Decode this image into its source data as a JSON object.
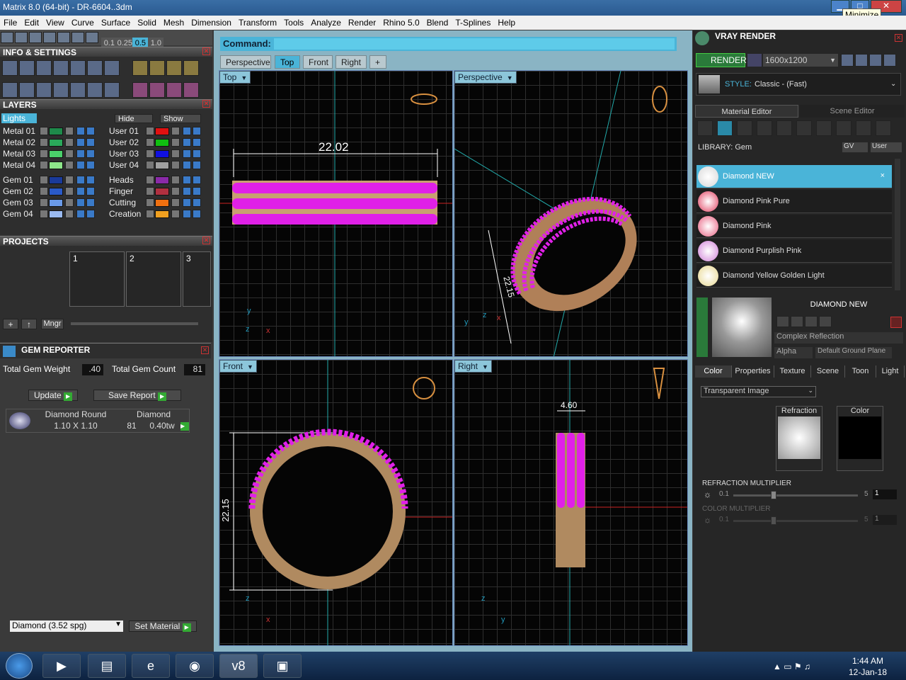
{
  "window": {
    "title": "Matrix 8.0 (64-bit) - DR-6604..3dm",
    "tooltip": "Minimize"
  },
  "menu": [
    "File",
    "Edit",
    "View",
    "Curve",
    "Surface",
    "Solid",
    "Mesh",
    "Dimension",
    "Transform",
    "Tools",
    "Analyze",
    "Render",
    "Rhino 5.0",
    "Blend",
    "T-Splines",
    "Help"
  ],
  "toolbar": {
    "nums": [
      "0.1",
      "0.25",
      "0.5",
      "1.0"
    ]
  },
  "info": {
    "title": "INFO & SETTINGS"
  },
  "layers": {
    "title": "LAYERS",
    "lights": "Lights",
    "hide": "Hide",
    "show": "Show",
    "left": [
      {
        "name": "Metal 01",
        "color": "#1e8a4a"
      },
      {
        "name": "Metal 02",
        "color": "#2aa85a"
      },
      {
        "name": "Metal 03",
        "color": "#4ad06a"
      },
      {
        "name": "Metal 04",
        "color": "#8ee68a"
      },
      {
        "name": "Gem 01",
        "color": "#1a3a9a"
      },
      {
        "name": "Gem 02",
        "color": "#2a5ac8"
      },
      {
        "name": "Gem 03",
        "color": "#6a9ae8"
      },
      {
        "name": "Gem 04",
        "color": "#9abaf0"
      }
    ],
    "right": [
      {
        "name": "User 01",
        "color": "#e01010"
      },
      {
        "name": "User 02",
        "color": "#10c010"
      },
      {
        "name": "User 03",
        "color": "#1010e0"
      },
      {
        "name": "User 04",
        "color": "#a0a0a0"
      },
      {
        "name": "Heads",
        "color": "#8a2aa8"
      },
      {
        "name": "Finger",
        "color": "#b03040"
      },
      {
        "name": "Cutting",
        "color": "#f07010"
      },
      {
        "name": "Creation",
        "color": "#f0a020"
      }
    ]
  },
  "projects": {
    "title": "PROJECTS",
    "slots": [
      "1",
      "2",
      "3"
    ],
    "mngr": "Mngr"
  },
  "gem": {
    "title": "GEM REPORTER",
    "weight_label": "Total Gem Weight",
    "weight": ".40",
    "count_label": "Total Gem Count",
    "count": "81",
    "update": "Update",
    "save": "Save Report",
    "shape": "Diamond Round",
    "size": "1.10 X 1.10",
    "type": "Diamond",
    "qty": "81",
    "tw": "0.40tw",
    "material": "Diamond    (3.52 spg)",
    "set_material": "Set Material"
  },
  "command": {
    "label": "Command:",
    "value": ""
  },
  "tabs": [
    "Perspective",
    "Top",
    "Front",
    "Right",
    "+"
  ],
  "viewports": {
    "top": "Top",
    "persp": "Perspective",
    "front": "Front",
    "right": "Right",
    "dim_top": "22.02",
    "dim_front": "22.15",
    "dim_right": "4.60",
    "dim_persp": "22.15"
  },
  "vray": {
    "title": "VRAY RENDER",
    "render": "RENDER",
    "resolution": "1600x1200",
    "style_label": "STYLE:",
    "style": "Classic - (Fast)",
    "tab_mat": "Material Editor",
    "tab_scene": "Scene Editor",
    "library": "LIBRARY: Gem",
    "gv": "GV",
    "user": "User",
    "materials": [
      {
        "name": "Diamond NEW",
        "color": "#d8d8d8"
      },
      {
        "name": "Diamond Pink Pure",
        "color": "#e04060"
      },
      {
        "name": "Diamond Pink",
        "color": "#e86080"
      },
      {
        "name": "Diamond Purplish Pink",
        "color": "#d080d8"
      },
      {
        "name": "Diamond Yellow Golden Light",
        "color": "#e8d890"
      }
    ],
    "selected": "DIAMOND NEW",
    "reflection": "Complex Reflection",
    "alpha": "Alpha",
    "ground": "Default Ground Plane",
    "subtabs": [
      "Color",
      "Properties",
      "Texture",
      "Scene",
      "Toon",
      "Light"
    ],
    "transparent": "Transparent Image",
    "refraction": "Refraction",
    "color": "Color",
    "refr_mult": "REFRACTION MULTIPLIER",
    "color_mult": "COLOR MULTIPLIER",
    "min": "0.1",
    "max": "5",
    "val": "1",
    "refr_level": 0.3,
    "color_level": 0.3
  },
  "taskbar": {
    "time": "1:44 AM",
    "date": "12-Jan-18"
  }
}
